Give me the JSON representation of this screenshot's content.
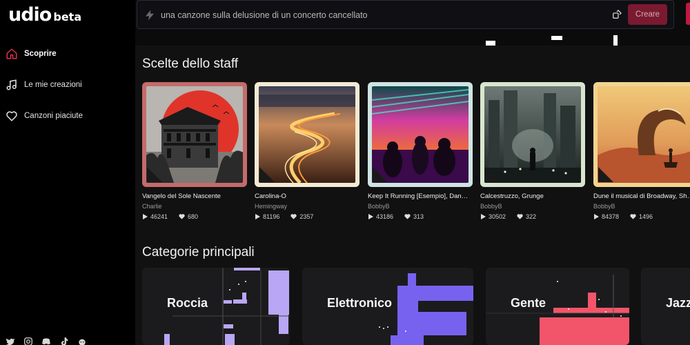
{
  "brand": {
    "logo": "udio",
    "badge": "beta"
  },
  "sidebar": {
    "items": [
      {
        "label": "Scoprire",
        "icon": "home-icon",
        "active": true
      },
      {
        "label": "Le mie creazioni",
        "icon": "music-note-icon",
        "active": false
      },
      {
        "label": "Canzoni piaciute",
        "icon": "heart-icon",
        "active": false
      }
    ],
    "socials": [
      "twitter-icon",
      "instagram-icon",
      "discord-icon",
      "tiktok-icon",
      "reddit-icon"
    ]
  },
  "prompt": {
    "placeholder": "una canzone sulla delusione di un concerto cancellato",
    "create_label": "Creare"
  },
  "staff_picks": {
    "title": "Scelte dello staff",
    "cards": [
      {
        "title": "Vangelo del Sole Nascente",
        "artist": "Charlie",
        "plays": "46241",
        "likes": "680",
        "frame": "#c46b6b"
      },
      {
        "title": "Carolina-O",
        "artist": "Hemingway",
        "plays": "81196",
        "likes": "2357",
        "frame": "#f2ead2"
      },
      {
        "title": "Keep It Running [Esempio], Dan…",
        "artist": "BobbyB",
        "plays": "43186",
        "likes": "313",
        "frame": "#cfe4e2"
      },
      {
        "title": "Calcestruzzo, Grunge",
        "artist": "BobbyB",
        "plays": "30502",
        "likes": "322",
        "frame": "#d9e6cf"
      },
      {
        "title": "Dune il musical di Broadway, Sh…",
        "artist": "BobbyB",
        "plays": "84378",
        "likes": "1496",
        "frame": "#f2d490"
      }
    ]
  },
  "categories": {
    "title": "Categorie principali",
    "items": [
      {
        "label": "Roccia",
        "color": "#b9a6f5"
      },
      {
        "label": "Elettronico",
        "color": "#7762f0"
      },
      {
        "label": "Gente",
        "color": "#f2556a"
      },
      {
        "label": "Jazz",
        "color": "#6fb1f0"
      }
    ]
  }
}
